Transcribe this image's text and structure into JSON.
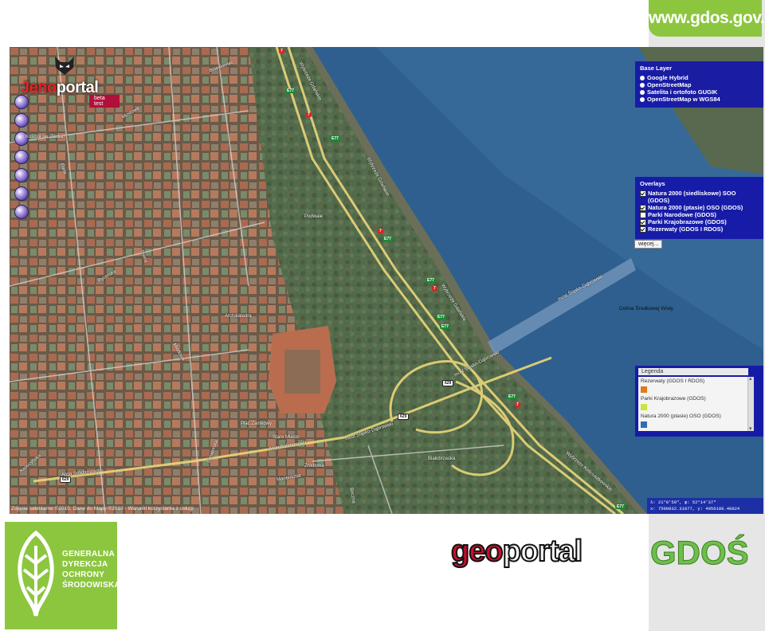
{
  "header": {
    "url": "www.gdos.gov.pl"
  },
  "jenoportal": {
    "name_part1": "Jeno",
    "name_part2": "portal",
    "badge": "beta test"
  },
  "tools": {
    "icons": [
      "zoom-in-icon",
      "zoom-out-icon",
      "pan-icon",
      "info-icon",
      "measure-icon",
      "print-icon",
      "search-icon"
    ]
  },
  "base_layer": {
    "title": "Base Layer",
    "options": [
      "Google Hybrid",
      "OpenStreetMap",
      "Satelita i ortofoto GUGIK",
      "OpenStreetMap w WGS84"
    ]
  },
  "overlays": {
    "title": "Overlays",
    "items": [
      {
        "label": "Natura 2000 (siedliskowe) SOO (GDOS)",
        "checked": true
      },
      {
        "label": "Natura 2000 (ptasie) OSO (GDOS)",
        "checked": true
      },
      {
        "label": "Parki Narodowe (GDOS)",
        "checked": false
      },
      {
        "label": "Parki Krajobrazowe (GDOS)",
        "checked": true
      },
      {
        "label": "Rezerwaty (GDOS I RDOS)",
        "checked": true
      }
    ],
    "more_label": "więcej..."
  },
  "legend": {
    "title": "Legenda",
    "items": [
      {
        "label": "Rezerwaty (GDOS I RDOS)",
        "color": "#e07a1c"
      },
      {
        "label": "Parki Krajobrazowe (GDOS)",
        "color": "#c8e63c"
      },
      {
        "label": "Natura 2000 (ptasie) OSO (GDOS)",
        "color": "#2f6db5"
      }
    ]
  },
  "map": {
    "area_label": "Dolina Środkowej Wisły",
    "streets": [
      "Wybrzeże Gdańskie",
      "most Śląsko-Dąbrowski",
      "Aleja Solidarności",
      "Bolesławiec",
      "Mostowa",
      "Freta",
      "Rycerska",
      "Piwna",
      "Boczna",
      "Zródłowa",
      "Mariensztat",
      "Białobrzeska",
      "Wybrzeże Kościuszkowskie",
      "Kapucyńska",
      "Senatorska",
      "Miodowa",
      "Podwale"
    ],
    "places": [
      "Kościół św. Jacka",
      "Archikatedra",
      "Plac Zamkowy",
      "Stare Miasto"
    ],
    "road_shields": [
      "7",
      "E77",
      "629"
    ],
    "attribution": "Zdjęcie satelitarne ©2010, Dane do Mapy ©2010 - Warunki korzystania z usługi",
    "coords_line1": "λ: 21°0'59\", φ: 52°14'37\"",
    "coords_line2": "x: 7500832.31077, y: 4956189.48824"
  },
  "gdos_logo": {
    "lines": [
      "GENERALNA",
      "DYREKCJA",
      "OCHRONY",
      "ŚRODOWISKA"
    ]
  },
  "brand": {
    "geo": "geo",
    "portal": "portal",
    "gdos": "GDOŚ"
  },
  "colors": {
    "brand_green": "#8cc63f",
    "panel_blue": "#1414aa",
    "river": "#2f5f8e"
  }
}
